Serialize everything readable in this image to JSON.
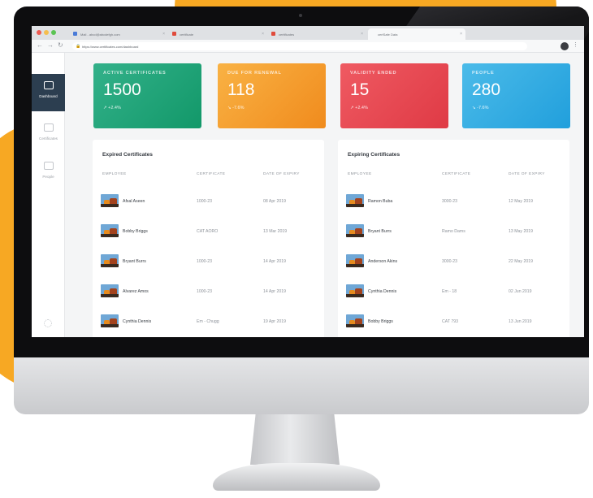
{
  "browser": {
    "tabs": [
      {
        "title": "Mail - abcd@abcdefgh.com"
      },
      {
        "title": "certificate"
      },
      {
        "title": "certificates"
      },
      {
        "title": "certSafe Data"
      }
    ],
    "url": "https://www.certificates.com/dashboard"
  },
  "sidebar": {
    "items": [
      {
        "label": "Dashboard",
        "icon": "dashboard-icon",
        "active": true
      },
      {
        "label": "Certificates",
        "icon": "certificate-icon",
        "active": false
      },
      {
        "label": "People",
        "icon": "people-icon",
        "active": false
      }
    ]
  },
  "stats": [
    {
      "title": "ACTIVE CERTIFICATES",
      "value": "1500",
      "delta": "↗ +2.4%",
      "color_start": "#33b18a",
      "color_end": "#129869"
    },
    {
      "title": "DUE FOR RENEWAL",
      "value": "118",
      "delta": "↘ -7.6%",
      "color_start": "#f9b244",
      "color_end": "#f08b1d"
    },
    {
      "title": "VALIDITY ENDED",
      "value": "15",
      "delta": "↗ +2.4%",
      "color_start": "#ef5a62",
      "color_end": "#df3a45"
    },
    {
      "title": "PEOPLE",
      "value": "280",
      "delta": "↘ -7.6%",
      "color_start": "#4bbbe9",
      "color_end": "#219fdc"
    }
  ],
  "expired": {
    "title": "Expired Certificates",
    "headers": {
      "employee": "EMPLOYEE",
      "certificate": "CERTIFICATE",
      "date": "DATE OF EXPIRY"
    },
    "rows": [
      {
        "employee": "Afsal Aseen",
        "certificate": "1000-23",
        "date": "08 Apr 2019"
      },
      {
        "employee": "Bobby Briggs",
        "certificate": "CAT AORO",
        "date": "13 Mar 2019"
      },
      {
        "employee": "Bryant Burrs",
        "certificate": "1000-23",
        "date": "14 Apr 2019"
      },
      {
        "employee": "Alvarez Amos",
        "certificate": "1000-23",
        "date": "14 Apr 2019"
      },
      {
        "employee": "Cynthia Dennis",
        "certificate": "Em - Chugg",
        "date": "19 Apr 2019"
      }
    ]
  },
  "expiring": {
    "title": "Expiring Certificates",
    "headers": {
      "employee": "EMPLOYEE",
      "certificate": "CERTIFICATE",
      "date": "DATE OF EXPIRY"
    },
    "rows": [
      {
        "employee": "Ramon Buba",
        "certificate": "3000-23",
        "date": "12 May 2019"
      },
      {
        "employee": "Bryant Burrs",
        "certificate": "Ramo Dams",
        "date": "13 May 2019"
      },
      {
        "employee": "Anderson Akins",
        "certificate": "3000-23",
        "date": "22 May 2019"
      },
      {
        "employee": "Cynthia Dennis",
        "certificate": "Em - 18",
        "date": "02 Jun 2019"
      },
      {
        "employee": "Bobby Briggs",
        "certificate": "CAT 793",
        "date": "13 Jun 2019"
      }
    ]
  }
}
